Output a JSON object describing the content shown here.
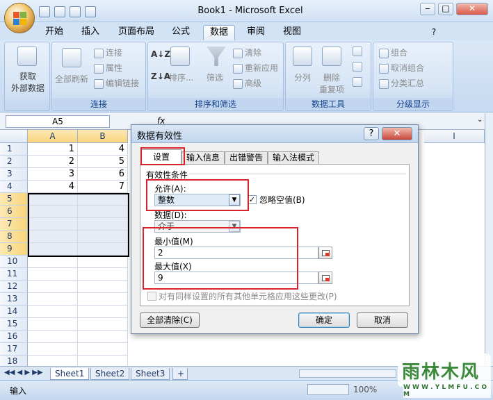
{
  "window": {
    "title": "Book1 - Microsoft Excel",
    "min": "‒",
    "max": "□",
    "close": "✕"
  },
  "ribbon_tabs": [
    "开始",
    "插入",
    "页面布局",
    "公式",
    "数据",
    "审阅",
    "视图"
  ],
  "ribbon": {
    "get_external_data": "获取\n外部数据",
    "refresh_all": "全部刷新",
    "connections": "连接",
    "properties": "属性",
    "edit_links": "编辑链接",
    "group_connections": "连接",
    "sort": "排序...",
    "filter": "筛选",
    "clear": "清除",
    "reapply": "重新应用",
    "advanced": "高级",
    "group_sort_filter": "排序和筛选",
    "text_to_columns": "分列",
    "remove_duplicates": "删除\n重复项",
    "group_data_tools": "数据工具",
    "group": "组合",
    "ungroup": "取消组合",
    "subtotal": "分类汇总",
    "group_outline": "分级显示"
  },
  "formula_bar": {
    "namebox": "A5",
    "fx": "fx"
  },
  "sheet": {
    "columns": [
      "A",
      "B",
      "I"
    ],
    "rows": [
      "1",
      "2",
      "3",
      "4",
      "5",
      "6",
      "7",
      "8",
      "9",
      "10",
      "11",
      "12",
      "13",
      "14",
      "15",
      "16",
      "17",
      "18"
    ],
    "col_a": [
      "1",
      "2",
      "3",
      "4"
    ],
    "col_b": [
      "4",
      "5",
      "6",
      "7"
    ]
  },
  "sheet_tabs": [
    "Sheet1",
    "Sheet2",
    "Sheet3"
  ],
  "status": {
    "mode": "输入",
    "zoom": "100%"
  },
  "dialog": {
    "title": "数据有效性",
    "help": "?",
    "close": "✕",
    "tabs": [
      "设置",
      "输入信息",
      "出错警告",
      "输入法模式"
    ],
    "section": "有效性条件",
    "allow_label": "允许(A):",
    "allow_value": "整数",
    "ignore_blank": "忽略空值(B)",
    "data_label": "数据(D):",
    "data_value": "介于",
    "min_label": "最小值(M)",
    "min_value": "2",
    "max_label": "最大值(X)",
    "max_value": "9",
    "apply_all": "对有同样设置的所有其他单元格应用这些更改(P)",
    "clear_all": "全部清除(C)",
    "ok": "确定",
    "cancel": "取消"
  },
  "watermark": {
    "text": "雨林木风",
    "url": "W W W . Y L M F U . C O M"
  },
  "colors": {
    "highlight": "#d8232a",
    "ribbon": "#c5d9f1",
    "header_sel": "#f9d57c"
  }
}
